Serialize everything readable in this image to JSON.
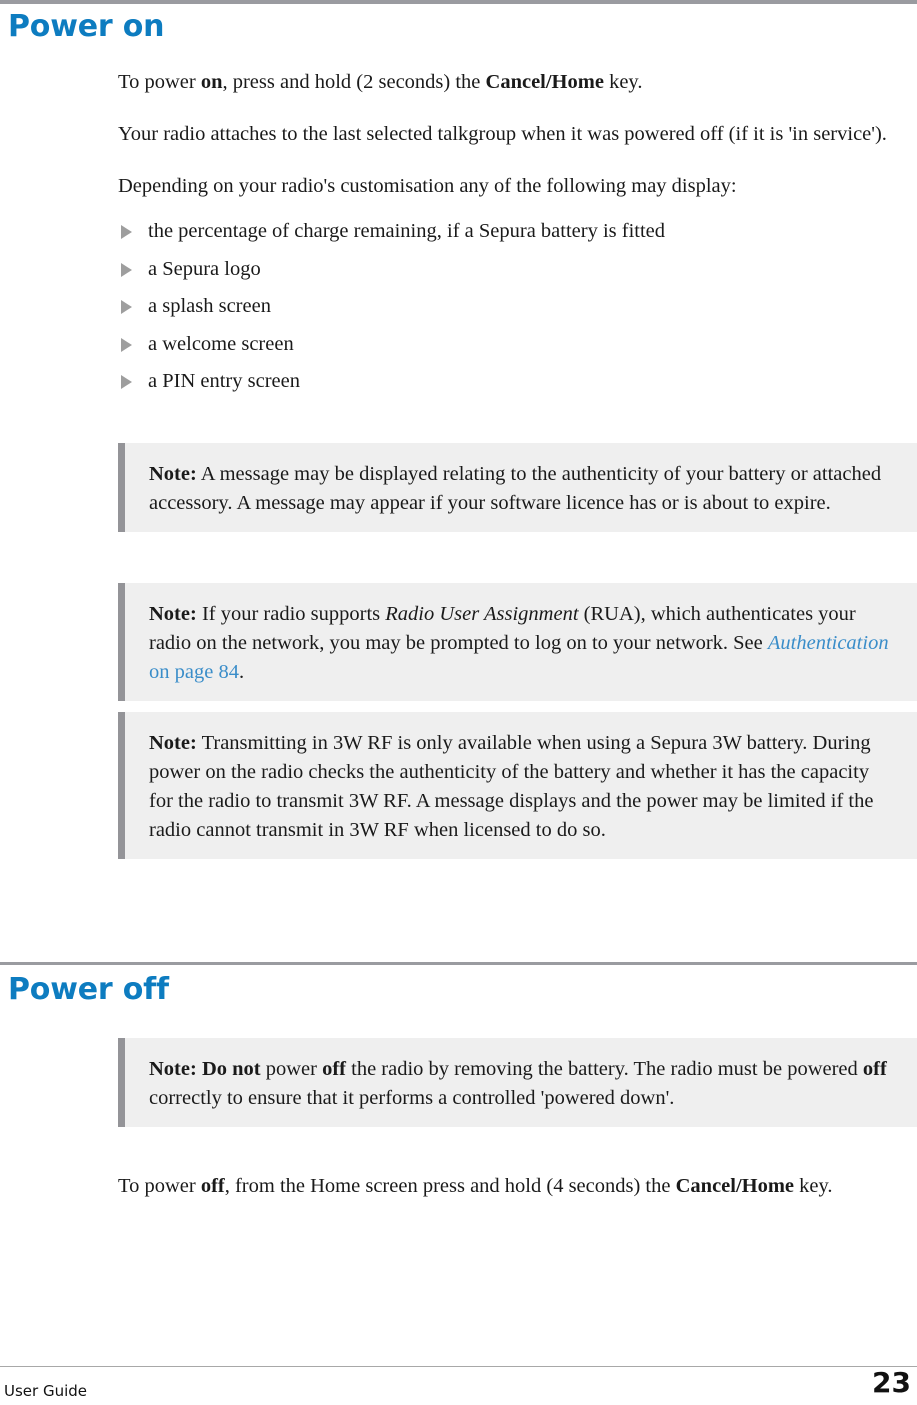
{
  "document": {
    "type": "user-guide-page",
    "colors": {
      "heading_blue": "#0d7cc0",
      "link_blue": "#3a8dc9",
      "note_background": "#efefef",
      "note_border": "#949498",
      "rule_gray": "#9a9ba0",
      "bullet_gray": "#9e9e9e"
    }
  },
  "sections": [
    {
      "heading": "Power on",
      "paragraphs": [
        {
          "runs": [
            {
              "text": "To power ",
              "style": "normal"
            },
            {
              "text": "on",
              "style": "bold"
            },
            {
              "text": ", press and hold (2 seconds) the ",
              "style": "normal"
            },
            {
              "text": "Cancel/Home",
              "style": "bold"
            },
            {
              "text": " key.",
              "style": "normal"
            }
          ]
        },
        {
          "runs": [
            {
              "text": "Your radio attaches to the last selected talkgroup when it was powered off (if it is 'in service').",
              "style": "normal"
            }
          ]
        },
        {
          "runs": [
            {
              "text": "Depending on your radio's customisation any of the following may display:",
              "style": "normal"
            }
          ]
        }
      ],
      "bullets": [
        "the percentage of charge remaining, if a Sepura battery is fitted",
        "a Sepura logo",
        "a splash screen",
        "a welcome screen",
        "a PIN entry screen"
      ],
      "notes": [
        {
          "label": "Note:",
          "runs": [
            {
              "text": " A message may be displayed relating to the authenticity of your battery or attached accessory. A message may appear if your software licence has or is about to expire.",
              "style": "normal"
            }
          ]
        },
        {
          "label": "Note:",
          "runs": [
            {
              "text": " If your radio supports ",
              "style": "normal"
            },
            {
              "text": "Radio User Assignment",
              "style": "italic"
            },
            {
              "text": " (RUA), which authenticates your radio on the network, you may be prompted to log on to your network. See ",
              "style": "normal"
            },
            {
              "text": "Authentication",
              "style": "link-italic"
            },
            {
              "text": " on page 84",
              "style": "link"
            },
            {
              "text": ".",
              "style": "normal"
            }
          ]
        },
        {
          "label": "Note:",
          "runs": [
            {
              "text": " Transmitting in 3W RF is only available when using a Sepura 3W battery. During power on the radio checks the authenticity of the battery and whether it has the capacity for the radio to transmit 3W RF. A message displays and the power may be limited if the radio cannot transmit in 3W RF when licensed to do so.",
              "style": "normal"
            }
          ]
        }
      ]
    },
    {
      "heading": "Power off",
      "notes": [
        {
          "label": "Note:",
          "runs": [
            {
              "text": " ",
              "style": "normal"
            },
            {
              "text": "Do not",
              "style": "bold"
            },
            {
              "text": " power ",
              "style": "normal"
            },
            {
              "text": "off",
              "style": "bold"
            },
            {
              "text": " the radio by removing the battery. The radio must be powered ",
              "style": "normal"
            },
            {
              "text": "off",
              "style": "bold"
            },
            {
              "text": " correctly to ensure that it performs a controlled 'powered down'.",
              "style": "normal"
            }
          ]
        }
      ],
      "paragraphs": [
        {
          "runs": [
            {
              "text": "To power ",
              "style": "normal"
            },
            {
              "text": "off",
              "style": "bold"
            },
            {
              "text": ", from the Home screen press and hold (4 seconds) the ",
              "style": "normal"
            },
            {
              "text": "Cancel/Home",
              "style": "bold"
            },
            {
              "text": " key.",
              "style": "normal"
            }
          ]
        }
      ]
    }
  ],
  "footer": {
    "left_label": "User Guide",
    "page_number": "23"
  }
}
